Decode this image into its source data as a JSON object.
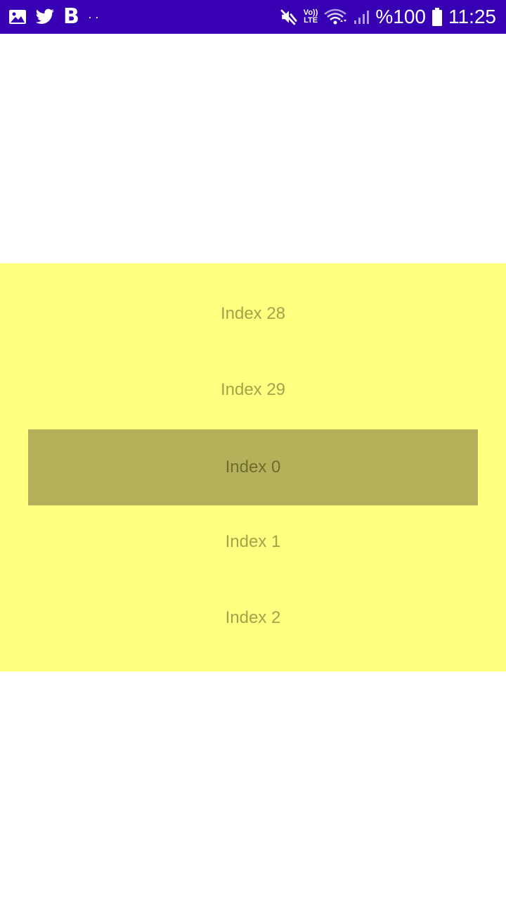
{
  "status_bar": {
    "background": "#3700b3",
    "left_icons": [
      "image-icon",
      "twitter-icon",
      "b-app-icon",
      "more-notifications-icon"
    ],
    "b_icon_text": "B",
    "dots_text": "··",
    "right_icons": [
      "mute-icon",
      "volte-icon",
      "wifi-icon",
      "signal-icon",
      "battery-icon"
    ],
    "volte_top": "Vo))",
    "volte_bottom": "LTE",
    "battery_percent": "%100",
    "time": "11:25"
  },
  "picker": {
    "background": "#ffff80",
    "selection_color": "#b4b15a",
    "items": [
      {
        "label": "Index 28"
      },
      {
        "label": "Index 29"
      },
      {
        "label": "Index 0",
        "selected": true
      },
      {
        "label": "Index 1"
      },
      {
        "label": "Index 2"
      }
    ]
  }
}
